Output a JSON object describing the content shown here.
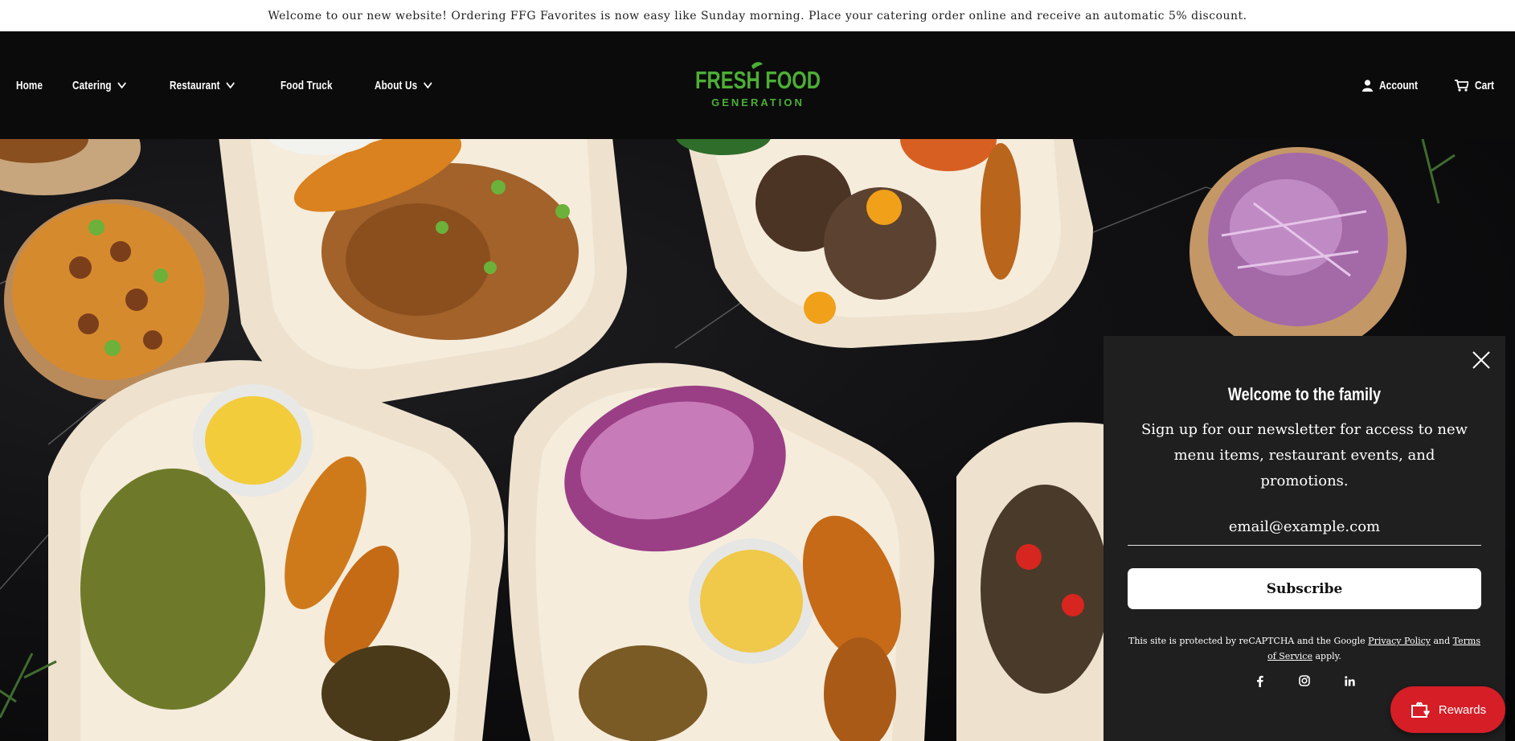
{
  "announcement": "Welcome to our new website! Ordering FFG Favorites is now easy like Sunday morning. Place your catering order online and receive an automatic 5% discount.",
  "nav": {
    "home": "Home",
    "catering": "Catering",
    "restaurant": "Restaurant",
    "food_truck": "Food Truck",
    "about": "About Us"
  },
  "logo": {
    "line1": "FRESH FOOD",
    "line2": "GENERATION"
  },
  "utility": {
    "account": "Account",
    "cart": "Cart"
  },
  "popup": {
    "title": "Welcome to the family",
    "description": "Sign up for our newsletter for access to new menu items, restaurant events, and promotions.",
    "email_placeholder": "email@example.com",
    "subscribe_label": "Subscribe",
    "legal_prefix": "This site is protected by reCAPTCHA and the Google",
    "privacy_link": "Privacy Policy",
    "legal_and": "and",
    "terms_link": "Terms of Service",
    "legal_suffix": "apply."
  },
  "rewards_label": "Rewards",
  "colors": {
    "brand_green": "#4caf34",
    "rewards_red": "#d61e27",
    "header_bg": "#0b0b0b"
  },
  "icons": [
    "chevron-down-icon",
    "user-icon",
    "cart-icon",
    "close-icon",
    "facebook-icon",
    "instagram-icon",
    "linkedin-icon",
    "gift-icon"
  ]
}
